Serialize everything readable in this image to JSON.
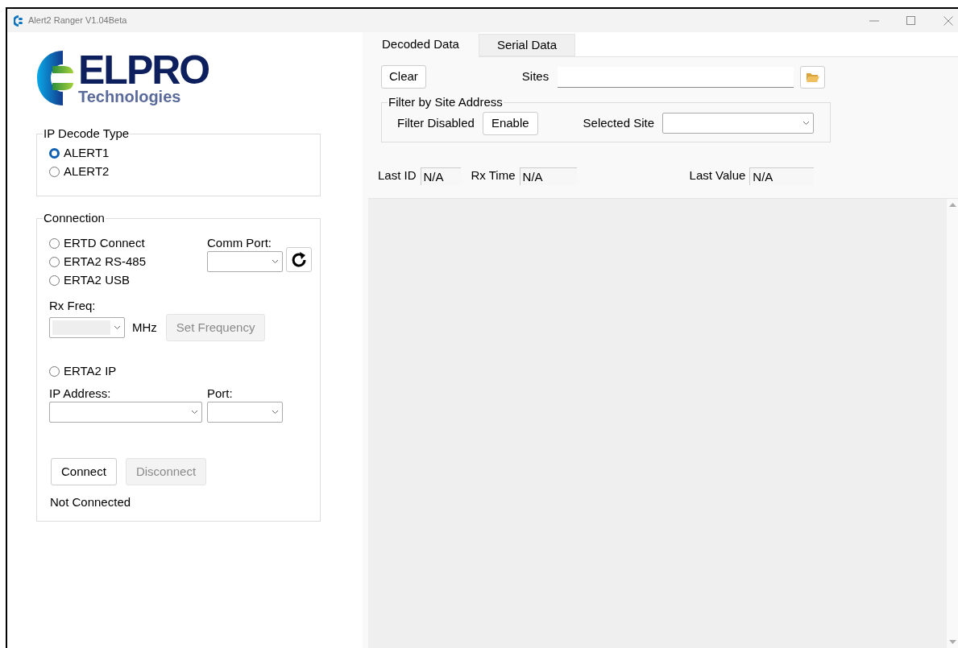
{
  "window": {
    "title": "Alert2 Ranger V1.04Beta"
  },
  "logo": {
    "name": "ELPRO",
    "subtitle": "Technologies"
  },
  "ip_decode_type": {
    "title": "IP Decode Type",
    "options": [
      {
        "label": "ALERT1",
        "selected": true
      },
      {
        "label": "ALERT2",
        "selected": false
      }
    ]
  },
  "connection": {
    "title": "Connection",
    "modes": [
      {
        "label": "ERTD Connect",
        "selected": false
      },
      {
        "label": "ERTA2 RS-485",
        "selected": false
      },
      {
        "label": "ERTA2 USB",
        "selected": false
      }
    ],
    "comm_port_label": "Comm Port:",
    "rx_freq_label": "Rx Freq:",
    "freq_unit": "MHz",
    "set_frequency": {
      "label": "Set Frequency",
      "disabled": true
    },
    "ip_mode": {
      "label": "ERTA2 IP",
      "selected": false
    },
    "ip_address_label": "IP Address:",
    "port_label": "Port:",
    "connect": {
      "label": "Connect",
      "disabled": false
    },
    "disconnect": {
      "label": "Disconnect",
      "disabled": true
    },
    "status": "Not Connected"
  },
  "tabs": [
    {
      "label": "Decoded Data",
      "selected": true
    },
    {
      "label": "Serial Data",
      "selected": false
    }
  ],
  "clear_button": "Clear",
  "sites_label": "Sites",
  "filter": {
    "title": "Filter by Site Address",
    "status": "Filter Disabled",
    "button": "Enable",
    "selected_site_label": "Selected Site"
  },
  "readouts": [
    {
      "label": "Last ID",
      "value": "N/A"
    },
    {
      "label": "Rx Time",
      "value": "N/A"
    },
    {
      "label": "Last Value",
      "value": "N/A"
    }
  ]
}
